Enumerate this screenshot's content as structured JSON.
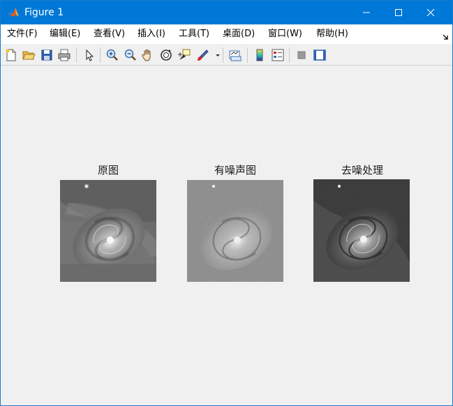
{
  "window": {
    "title": "Figure 1",
    "accent_color": "#0078d7",
    "app_icon": "matlab-icon",
    "controls": [
      "minimize-icon",
      "maximize-icon",
      "close-icon"
    ]
  },
  "menu": {
    "items": [
      {
        "label": "文件(F)"
      },
      {
        "label": "编辑(E)"
      },
      {
        "label": "查看(V)"
      },
      {
        "label": "插入(I)"
      },
      {
        "label": "工具(T)"
      },
      {
        "label": "桌面(D)"
      },
      {
        "label": "窗口(W)"
      },
      {
        "label": "帮助(H)"
      }
    ]
  },
  "toolbar": {
    "tools": [
      "new-figure-icon",
      "open-file-icon",
      "save-icon",
      "print-icon",
      "pointer-icon",
      "zoom-in-icon",
      "zoom-out-icon",
      "pan-hand-icon",
      "rotate-3d-icon",
      "data-cursor-icon",
      "brush-icon",
      "brush-dropdown-icon",
      "link-plot-icon",
      "colorbar-icon",
      "legend-icon",
      "hide-plot-tools-icon",
      "show-plot-tools-icon"
    ]
  },
  "figure": {
    "panels": [
      {
        "title": "原图",
        "style": "original"
      },
      {
        "title": "有噪声图",
        "style": "noisy"
      },
      {
        "title": "去噪处理",
        "style": "denoised"
      }
    ]
  }
}
